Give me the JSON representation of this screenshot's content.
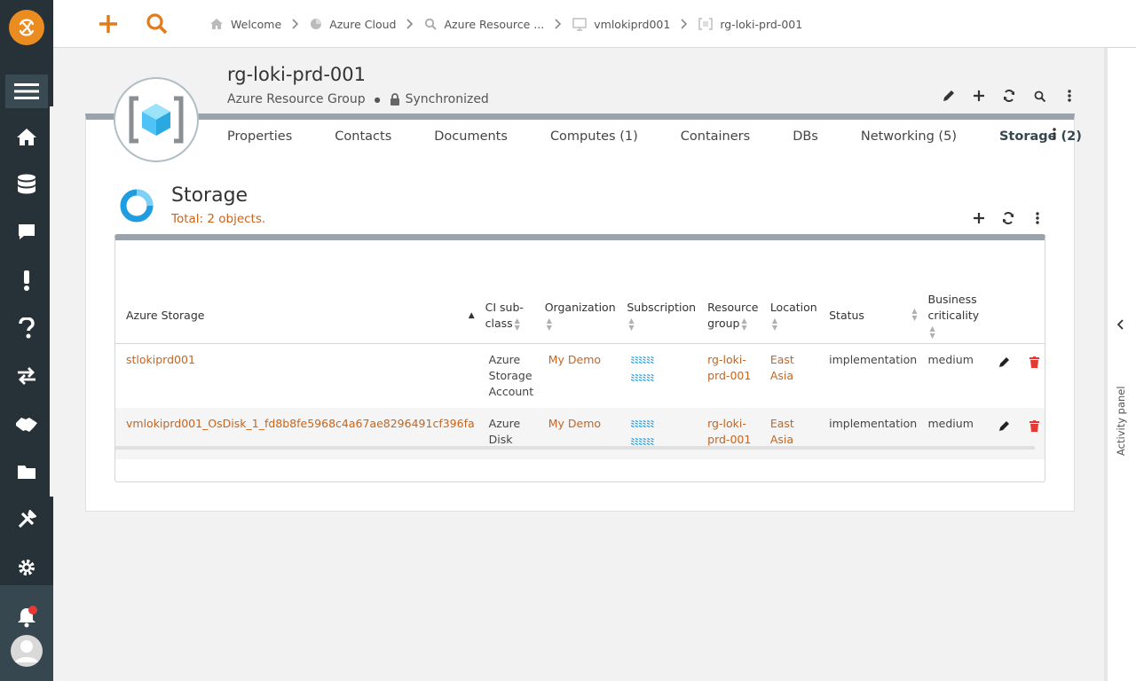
{
  "app": {
    "logo_icon": "app-logo-icon",
    "accent": "#ea8c1f",
    "link_color": "#c8641c"
  },
  "topbar": {
    "add_icon": "plus-icon",
    "search_icon": "search-icon",
    "breadcrumbs": [
      {
        "label": "Welcome",
        "icon": "home-icon"
      },
      {
        "label": "Azure Cloud",
        "icon": "pie-chart-icon"
      },
      {
        "label": "Azure Resource ...",
        "icon": "search-icon"
      },
      {
        "label": "vmlokiprd001",
        "icon": "monitor-icon"
      },
      {
        "label": "rg-loki-prd-001",
        "icon": "resource-group-icon"
      }
    ]
  },
  "sidebar": {
    "items": [
      "menu-icon",
      "home-icon",
      "database-icon",
      "chat-icon",
      "alert-icon",
      "help-icon",
      "exchange-icon",
      "handshake-icon",
      "folder-icon",
      "tools-icon",
      "settings-icon",
      "bell-icon",
      "avatar-icon"
    ]
  },
  "object": {
    "title": "rg-loki-prd-001",
    "type": "Azure Resource Group",
    "sync_status": "Synchronized"
  },
  "tabs": [
    {
      "label": "Properties"
    },
    {
      "label": "Contacts"
    },
    {
      "label": "Documents"
    },
    {
      "label": "Computes (1)"
    },
    {
      "label": "Containers"
    },
    {
      "label": "DBs"
    },
    {
      "label": "Networking (5)"
    },
    {
      "label": "Storage (2)",
      "active": true
    }
  ],
  "section": {
    "title": "Storage",
    "total": "Total: 2 objects."
  },
  "table": {
    "columns": [
      "Azure Storage",
      "CI sub-class",
      "Organization",
      "Subscription",
      "Resource group",
      "Location",
      "Status",
      "Business criticality"
    ],
    "rows": [
      {
        "name": "stlokiprd001",
        "subclass": "Azure Storage Account",
        "organization": "My Demo",
        "subscription": "redacted",
        "resource_group": "rg-loki-prd-001",
        "location": "East Asia",
        "status": "implementation",
        "criticality": "medium"
      },
      {
        "name": "vmlokiprd001_OsDisk_1_fd8b8fe5968c4a67ae8296491cf396fa",
        "subclass": "Azure Disk",
        "organization": "My Demo",
        "subscription": "redacted",
        "resource_group": "rg-loki-prd-001",
        "location": "East Asia",
        "status": "implementation",
        "criticality": "medium"
      }
    ]
  },
  "activity_panel": {
    "label": "Activity panel"
  }
}
